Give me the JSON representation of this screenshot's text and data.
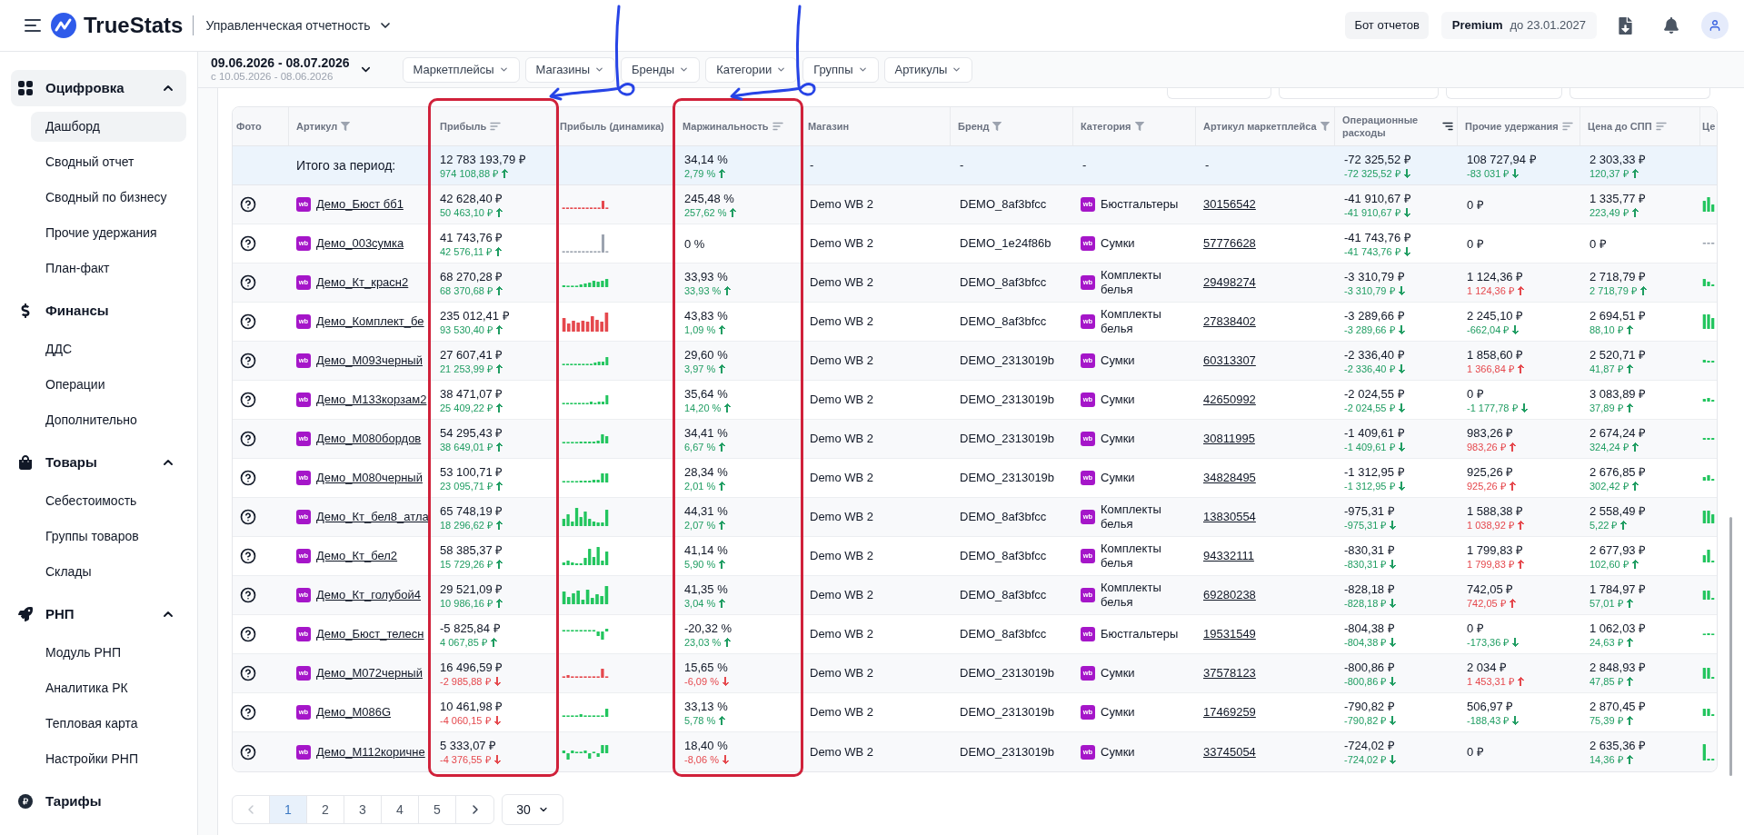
{
  "header": {
    "app_name": "TrueStats",
    "report": "Управленческая отчетность",
    "bot_button": "Бот отчетов",
    "plan": {
      "name": "Premium",
      "until": "до 23.01.2027"
    }
  },
  "sidebar": {
    "sections": [
      {
        "label": "Оцифровка",
        "active": true,
        "collapsible": true,
        "expanded": true,
        "items": [
          {
            "label": "Дашборд",
            "selected": true
          },
          {
            "label": "Сводный отчет",
            "selected": false
          },
          {
            "label": "Сводный по бизнесу",
            "selected": false
          },
          {
            "label": "Прочие удержания",
            "selected": false
          },
          {
            "label": "План-факт",
            "selected": false
          }
        ]
      },
      {
        "label": "Финансы",
        "active": false,
        "collapsible": false,
        "items": [
          {
            "label": "ДДС",
            "selected": false
          },
          {
            "label": "Операции",
            "selected": false
          },
          {
            "label": "Дополнительно",
            "selected": false
          }
        ]
      },
      {
        "label": "Товары",
        "active": false,
        "collapsible": true,
        "expanded": true,
        "items": [
          {
            "label": "Себестоимость",
            "selected": false
          },
          {
            "label": "Группы товаров",
            "selected": false
          },
          {
            "label": "Склады",
            "selected": false
          }
        ]
      },
      {
        "label": "РНП",
        "active": false,
        "collapsible": true,
        "expanded": true,
        "items": [
          {
            "label": "Модуль РНП",
            "selected": false
          },
          {
            "label": "Аналитика РК",
            "selected": false
          },
          {
            "label": "Тепловая карта",
            "selected": false
          },
          {
            "label": "Настройки РНП",
            "selected": false
          }
        ]
      },
      {
        "label": "Тарифы",
        "active": false,
        "collapsible": false
      }
    ]
  },
  "filters": {
    "period": "09.06.2026 - 08.07.2026",
    "comparison": "с 10.05.2026 - 08.06.2026",
    "chips": [
      "Маркетплейсы",
      "Магазины",
      "Бренды",
      "Категории",
      "Группы",
      "Артикулы"
    ]
  },
  "table": {
    "columns": [
      {
        "label": "Фото",
        "kind": "plain",
        "highlighted": false
      },
      {
        "label": "Артикул",
        "kind": "filter",
        "highlighted": false
      },
      {
        "label": "Прибыль",
        "kind": "sort",
        "sorted": false,
        "highlighted": true
      },
      {
        "label": "Прибыль (динамика)",
        "kind": "plain",
        "highlighted": false
      },
      {
        "label": "Маржинальность",
        "kind": "sort",
        "sorted": false,
        "highlighted": true
      },
      {
        "label": "Магазин",
        "kind": "plain",
        "highlighted": false
      },
      {
        "label": "Бренд",
        "kind": "filter",
        "highlighted": false
      },
      {
        "label": "Категория",
        "kind": "filter",
        "highlighted": false
      },
      {
        "label": "Артикул маркетплейса",
        "kind": "filter",
        "highlighted": false
      },
      {
        "label": "Операционные расходы",
        "kind": "sort",
        "sorted": true,
        "highlighted": false
      },
      {
        "label": "Прочие удержания",
        "kind": "sort",
        "sorted": false,
        "highlighted": false
      },
      {
        "label": "Цена до СПП",
        "kind": "sort",
        "sorted": false,
        "highlighted": false
      },
      {
        "label": "Це",
        "kind": "plain",
        "highlighted": false
      }
    ],
    "total": {
      "label": "Итого за период:",
      "profit": {
        "value": "12 783 193,79 ₽",
        "delta": {
          "value": "974 108,88 ₽",
          "rising": true,
          "color": "#1f9d62"
        }
      },
      "margin": {
        "value": "34,14 %",
        "delta": {
          "value": "2,79 %",
          "rising": true,
          "color": "#1f9d62"
        }
      },
      "store": "-",
      "brand": "-",
      "category": "-",
      "marketplace_article": "-",
      "operating_expenses": {
        "value": "-72 325,52 ₽",
        "delta": {
          "value": "-72 325,52 ₽",
          "rising": false,
          "color": "#1f9d62"
        }
      },
      "other_deductions": {
        "value": "108 727,94 ₽",
        "delta": {
          "value": "-83 031 ₽",
          "rising": false,
          "color": "#1f9d62"
        }
      },
      "price_before_spp": {
        "value": "2 303,33 ₽",
        "delta": {
          "value": "120,37 ₽",
          "rising": true,
          "color": "#1f9d62"
        }
      }
    },
    "rows": [
      {
        "article": {
          "badge": "wb",
          "name": "Демо_Бюст бб1"
        },
        "profit": {
          "value": "42 628,40 ₽",
          "delta": {
            "value": "50 463,10 ₽",
            "rising": true,
            "color": "#1f9d62"
          }
        },
        "profit_dynamics": {
          "color": "#e5484d"
        },
        "margin": {
          "value": "245,48 %",
          "delta": {
            "value": "257,62 %",
            "rising": true,
            "color": "#1f9d62"
          }
        },
        "store": "Demo WB 2",
        "brand": "DEMO_8af3bfcc",
        "category": {
          "badge": "wb",
          "name": "Бюстгальтеры"
        },
        "marketplace_article": "30156542",
        "operating_expenses": {
          "value": "-41 910,67 ₽",
          "delta": {
            "value": "-41 910,67 ₽",
            "rising": false,
            "color": "#1f9d62"
          }
        },
        "other_deductions": {
          "value": "0 ₽"
        },
        "price_before_spp": {
          "value": "1 335,77 ₽",
          "delta": {
            "value": "223,49 ₽",
            "rising": true,
            "color": "#1f9d62"
          }
        },
        "column_13": {
          "color": "#22c55e"
        }
      },
      {
        "article": {
          "badge": "wb",
          "name": "Демо_003сумка"
        },
        "profit": {
          "value": "41 743,76 ₽",
          "delta": {
            "value": "42 576,11 ₽",
            "rising": true,
            "color": "#1f9d62"
          }
        },
        "profit_dynamics": {
          "color": "#9ca3af"
        },
        "margin": {
          "value": "0 %"
        },
        "store": "Demo WB 2",
        "brand": "DEMO_1e24f86b",
        "category": {
          "badge": "wb",
          "name": "Сумки"
        },
        "marketplace_article": "57776628",
        "operating_expenses": {
          "value": "-41 743,76 ₽",
          "delta": {
            "value": "-41 743,76 ₽",
            "rising": false,
            "color": "#1f9d62"
          }
        },
        "other_deductions": {
          "value": "0 ₽"
        },
        "price_before_spp": {
          "value": "0 ₽"
        },
        "column_13": {
          "color": "#9ca3af"
        }
      },
      {
        "article": {
          "badge": "wb",
          "name": "Демо_Кт_красн2"
        },
        "profit": {
          "value": "68 270,28 ₽",
          "delta": {
            "value": "68 370,68 ₽",
            "rising": true,
            "color": "#1f9d62"
          }
        },
        "profit_dynamics": {
          "color": "#22c55e"
        },
        "margin": {
          "value": "33,93 %",
          "delta": {
            "value": "33,93 %",
            "rising": true,
            "color": "#1f9d62"
          }
        },
        "store": "Demo WB 2",
        "brand": "DEMO_8af3bfcc",
        "category": {
          "badge": "wb",
          "name": "Комплекты белья"
        },
        "marketplace_article": "29498274",
        "operating_expenses": {
          "value": "-3 310,79 ₽",
          "delta": {
            "value": "-3 310,79 ₽",
            "rising": false,
            "color": "#1f9d62"
          }
        },
        "other_deductions": {
          "value": "1 124,36 ₽",
          "delta": {
            "value": "1 124,36 ₽",
            "rising": true,
            "color": "#e5484d"
          }
        },
        "price_before_spp": {
          "value": "2 718,79 ₽",
          "delta": {
            "value": "2 718,79 ₽",
            "rising": true,
            "color": "#1f9d62"
          }
        },
        "column_13": {
          "color": "#22c55e"
        }
      },
      {
        "article": {
          "badge": "wb",
          "name": "Демо_Комплект_бе"
        },
        "profit": {
          "value": "235 012,41 ₽",
          "delta": {
            "value": "93 530,40 ₽",
            "rising": true,
            "color": "#1f9d62"
          }
        },
        "profit_dynamics": {
          "color": "#e5484d"
        },
        "margin": {
          "value": "43,83 %",
          "delta": {
            "value": "1,09 %",
            "rising": true,
            "color": "#1f9d62"
          }
        },
        "store": "Demo WB 2",
        "brand": "DEMO_8af3bfcc",
        "category": {
          "badge": "wb",
          "name": "Комплекты белья"
        },
        "marketplace_article": "27838402",
        "operating_expenses": {
          "value": "-3 289,66 ₽",
          "delta": {
            "value": "-3 289,66 ₽",
            "rising": false,
            "color": "#1f9d62"
          }
        },
        "other_deductions": {
          "value": "2 245,10 ₽",
          "delta": {
            "value": "-662,04 ₽",
            "rising": false,
            "color": "#1f9d62"
          }
        },
        "price_before_spp": {
          "value": "2 694,51 ₽",
          "delta": {
            "value": "88,10 ₽",
            "rising": true,
            "color": "#1f9d62"
          }
        },
        "column_13": {
          "color": "#22c55e"
        }
      },
      {
        "article": {
          "badge": "wb",
          "name": "Демо_М093черный"
        },
        "profit": {
          "value": "27 607,41 ₽",
          "delta": {
            "value": "21 253,99 ₽",
            "rising": true,
            "color": "#1f9d62"
          }
        },
        "profit_dynamics": {
          "color": "#22c55e"
        },
        "margin": {
          "value": "29,60 %",
          "delta": {
            "value": "3,97 %",
            "rising": true,
            "color": "#1f9d62"
          }
        },
        "store": "Demo WB 2",
        "brand": "DEMO_2313019b",
        "category": {
          "badge": "wb",
          "name": "Сумки"
        },
        "marketplace_article": "60313307",
        "operating_expenses": {
          "value": "-2 336,40 ₽",
          "delta": {
            "value": "-2 336,40 ₽",
            "rising": false,
            "color": "#1f9d62"
          }
        },
        "other_deductions": {
          "value": "1 858,60 ₽",
          "delta": {
            "value": "1 366,84 ₽",
            "rising": true,
            "color": "#e5484d"
          }
        },
        "price_before_spp": {
          "value": "2 520,71 ₽",
          "delta": {
            "value": "41,87 ₽",
            "rising": true,
            "color": "#1f9d62"
          }
        },
        "column_13": {
          "color": "#22c55e"
        }
      },
      {
        "article": {
          "badge": "wb",
          "name": "Демо_М133корзам2"
        },
        "profit": {
          "value": "38 471,07 ₽",
          "delta": {
            "value": "25 409,22 ₽",
            "rising": true,
            "color": "#1f9d62"
          }
        },
        "profit_dynamics": {
          "color": "#22c55e"
        },
        "margin": {
          "value": "35,64 %",
          "delta": {
            "value": "14,20 %",
            "rising": true,
            "color": "#1f9d62"
          }
        },
        "store": "Demo WB 2",
        "brand": "DEMO_2313019b",
        "category": {
          "badge": "wb",
          "name": "Сумки"
        },
        "marketplace_article": "42650992",
        "operating_expenses": {
          "value": "-2 024,55 ₽",
          "delta": {
            "value": "-2 024,55 ₽",
            "rising": false,
            "color": "#1f9d62"
          }
        },
        "other_deductions": {
          "value": "0 ₽",
          "delta": {
            "value": "-1 177,78 ₽",
            "rising": false,
            "color": "#1f9d62"
          }
        },
        "price_before_spp": {
          "value": "3 083,89 ₽",
          "delta": {
            "value": "37,89 ₽",
            "rising": true,
            "color": "#1f9d62"
          }
        },
        "column_13": {
          "color": "#22c55e"
        }
      },
      {
        "article": {
          "badge": "wb",
          "name": "Демо_М080бордов"
        },
        "profit": {
          "value": "54 295,43 ₽",
          "delta": {
            "value": "38 649,01 ₽",
            "rising": true,
            "color": "#1f9d62"
          }
        },
        "profit_dynamics": {
          "color": "#22c55e"
        },
        "margin": {
          "value": "34,41 %",
          "delta": {
            "value": "6,67 %",
            "rising": true,
            "color": "#1f9d62"
          }
        },
        "store": "Demo WB 2",
        "brand": "DEMO_2313019b",
        "category": {
          "badge": "wb",
          "name": "Сумки"
        },
        "marketplace_article": "30811995",
        "operating_expenses": {
          "value": "-1 409,61 ₽",
          "delta": {
            "value": "-1 409,61 ₽",
            "rising": false,
            "color": "#1f9d62"
          }
        },
        "other_deductions": {
          "value": "983,26 ₽",
          "delta": {
            "value": "983,26 ₽",
            "rising": true,
            "color": "#e5484d"
          }
        },
        "price_before_spp": {
          "value": "2 674,24 ₽",
          "delta": {
            "value": "324,24 ₽",
            "rising": true,
            "color": "#1f9d62"
          }
        },
        "column_13": {
          "color": "#22c55e"
        }
      },
      {
        "article": {
          "badge": "wb",
          "name": "Демо_М080черный"
        },
        "profit": {
          "value": "53 100,71 ₽",
          "delta": {
            "value": "23 095,71 ₽",
            "rising": true,
            "color": "#1f9d62"
          }
        },
        "profit_dynamics": {
          "color": "#22c55e"
        },
        "margin": {
          "value": "28,34 %",
          "delta": {
            "value": "2,01 %",
            "rising": true,
            "color": "#1f9d62"
          }
        },
        "store": "Demo WB 2",
        "brand": "DEMO_2313019b",
        "category": {
          "badge": "wb",
          "name": "Сумки"
        },
        "marketplace_article": "34828495",
        "operating_expenses": {
          "value": "-1 312,95 ₽",
          "delta": {
            "value": "-1 312,95 ₽",
            "rising": false,
            "color": "#1f9d62"
          }
        },
        "other_deductions": {
          "value": "925,26 ₽",
          "delta": {
            "value": "925,26 ₽",
            "rising": true,
            "color": "#e5484d"
          }
        },
        "price_before_spp": {
          "value": "2 676,85 ₽",
          "delta": {
            "value": "302,42 ₽",
            "rising": true,
            "color": "#1f9d62"
          }
        },
        "column_13": {
          "color": "#22c55e"
        }
      },
      {
        "article": {
          "badge": "wb",
          "name": "Демо_Кт_бел8_атла"
        },
        "profit": {
          "value": "65 748,19 ₽",
          "delta": {
            "value": "18 296,62 ₽",
            "rising": true,
            "color": "#1f9d62"
          }
        },
        "profit_dynamics": {
          "color": "#22c55e"
        },
        "margin": {
          "value": "44,31 %",
          "delta": {
            "value": "2,07 %",
            "rising": true,
            "color": "#1f9d62"
          }
        },
        "store": "Demo WB 2",
        "brand": "DEMO_8af3bfcc",
        "category": {
          "badge": "wb",
          "name": "Комплекты белья"
        },
        "marketplace_article": "13830554",
        "operating_expenses": {
          "value": "-975,31 ₽",
          "delta": {
            "value": "-975,31 ₽",
            "rising": false,
            "color": "#1f9d62"
          }
        },
        "other_deductions": {
          "value": "1 588,38 ₽",
          "delta": {
            "value": "1 038,92 ₽",
            "rising": true,
            "color": "#e5484d"
          }
        },
        "price_before_spp": {
          "value": "2 558,49 ₽",
          "delta": {
            "value": "5,22 ₽",
            "rising": true,
            "color": "#1f9d62"
          }
        },
        "column_13": {
          "color": "#22c55e"
        }
      },
      {
        "article": {
          "badge": "wb",
          "name": "Демо_Кт_бел2"
        },
        "profit": {
          "value": "58 385,37 ₽",
          "delta": {
            "value": "15 729,26 ₽",
            "rising": true,
            "color": "#1f9d62"
          }
        },
        "profit_dynamics": {
          "color": "#22c55e"
        },
        "margin": {
          "value": "41,14 %",
          "delta": {
            "value": "5,90 %",
            "rising": true,
            "color": "#1f9d62"
          }
        },
        "store": "Demo WB 2",
        "brand": "DEMO_8af3bfcc",
        "category": {
          "badge": "wb",
          "name": "Комплекты белья"
        },
        "marketplace_article": "94332111",
        "operating_expenses": {
          "value": "-830,31 ₽",
          "delta": {
            "value": "-830,31 ₽",
            "rising": false,
            "color": "#1f9d62"
          }
        },
        "other_deductions": {
          "value": "1 799,83 ₽",
          "delta": {
            "value": "1 799,83 ₽",
            "rising": true,
            "color": "#e5484d"
          }
        },
        "price_before_spp": {
          "value": "2 677,93 ₽",
          "delta": {
            "value": "102,60 ₽",
            "rising": true,
            "color": "#1f9d62"
          }
        },
        "column_13": {
          "color": "#22c55e"
        }
      },
      {
        "article": {
          "badge": "wb",
          "name": "Демо_Кт_голубой4"
        },
        "profit": {
          "value": "29 521,09 ₽",
          "delta": {
            "value": "10 986,16 ₽",
            "rising": true,
            "color": "#1f9d62"
          }
        },
        "profit_dynamics": {
          "color": "#22c55e"
        },
        "margin": {
          "value": "41,35 %",
          "delta": {
            "value": "3,04 %",
            "rising": true,
            "color": "#1f9d62"
          }
        },
        "store": "Demo WB 2",
        "brand": "DEMO_8af3bfcc",
        "category": {
          "badge": "wb",
          "name": "Комплекты белья"
        },
        "marketplace_article": "69280238",
        "operating_expenses": {
          "value": "-828,18 ₽",
          "delta": {
            "value": "-828,18 ₽",
            "rising": false,
            "color": "#1f9d62"
          }
        },
        "other_deductions": {
          "value": "742,05 ₽",
          "delta": {
            "value": "742,05 ₽",
            "rising": true,
            "color": "#e5484d"
          }
        },
        "price_before_spp": {
          "value": "1 784,97 ₽",
          "delta": {
            "value": "57,01 ₽",
            "rising": true,
            "color": "#1f9d62"
          }
        },
        "column_13": {
          "color": "#22c55e"
        }
      },
      {
        "article": {
          "badge": "wb",
          "name": "Демо_Бюст_телесн"
        },
        "profit": {
          "value": "-5 825,84 ₽",
          "delta": {
            "value": "4 067,85 ₽",
            "rising": true,
            "color": "#1f9d62"
          }
        },
        "profit_dynamics": {
          "color": "#22c55e"
        },
        "margin": {
          "value": "-20,32 %",
          "delta": {
            "value": "23,03 %",
            "rising": true,
            "color": "#1f9d62"
          }
        },
        "store": "Demo WB 2",
        "brand": "DEMO_8af3bfcc",
        "category": {
          "badge": "wb",
          "name": "Бюстгальтеры"
        },
        "marketplace_article": "19531549",
        "operating_expenses": {
          "value": "-804,38 ₽",
          "delta": {
            "value": "-804,38 ₽",
            "rising": false,
            "color": "#1f9d62"
          }
        },
        "other_deductions": {
          "value": "0 ₽",
          "delta": {
            "value": "-173,36 ₽",
            "rising": false,
            "color": "#1f9d62"
          }
        },
        "price_before_spp": {
          "value": "1 062,03 ₽",
          "delta": {
            "value": "24,63 ₽",
            "rising": true,
            "color": "#1f9d62"
          }
        },
        "column_13": {
          "color": "#22c55e"
        }
      },
      {
        "article": {
          "badge": "wb",
          "name": "Демо_М072черный"
        },
        "profit": {
          "value": "16 496,59 ₽",
          "delta": {
            "value": "-2 985,88 ₽",
            "rising": false,
            "color": "#e5484d"
          }
        },
        "profit_dynamics": {
          "color": "#e5484d"
        },
        "margin": {
          "value": "15,65 %",
          "delta": {
            "value": "-6,09 %",
            "rising": false,
            "color": "#e5484d"
          }
        },
        "store": "Demo WB 2",
        "brand": "DEMO_2313019b",
        "category": {
          "badge": "wb",
          "name": "Сумки"
        },
        "marketplace_article": "37578123",
        "operating_expenses": {
          "value": "-800,86 ₽",
          "delta": {
            "value": "-800,86 ₽",
            "rising": false,
            "color": "#1f9d62"
          }
        },
        "other_deductions": {
          "value": "2 034 ₽",
          "delta": {
            "value": "1 453,31 ₽",
            "rising": true,
            "color": "#e5484d"
          }
        },
        "price_before_spp": {
          "value": "2 848,93 ₽",
          "delta": {
            "value": "47,85 ₽",
            "rising": true,
            "color": "#1f9d62"
          }
        },
        "column_13": {
          "color": "#22c55e"
        }
      },
      {
        "article": {
          "badge": "wb",
          "name": "Демо_М086G"
        },
        "profit": {
          "value": "10 461,98 ₽",
          "delta": {
            "value": "-4 060,15 ₽",
            "rising": false,
            "color": "#e5484d"
          }
        },
        "profit_dynamics": {
          "color": "#22c55e"
        },
        "margin": {
          "value": "33,13 %",
          "delta": {
            "value": "5,78 %",
            "rising": true,
            "color": "#1f9d62"
          }
        },
        "store": "Demo WB 2",
        "brand": "DEMO_2313019b",
        "category": {
          "badge": "wb",
          "name": "Сумки"
        },
        "marketplace_article": "17469259",
        "operating_expenses": {
          "value": "-790,82 ₽",
          "delta": {
            "value": "-790,82 ₽",
            "rising": false,
            "color": "#1f9d62"
          }
        },
        "other_deductions": {
          "value": "506,97 ₽",
          "delta": {
            "value": "-188,43 ₽",
            "rising": false,
            "color": "#1f9d62"
          }
        },
        "price_before_spp": {
          "value": "2 870,45 ₽",
          "delta": {
            "value": "75,39 ₽",
            "rising": true,
            "color": "#1f9d62"
          }
        },
        "column_13": {
          "color": "#22c55e"
        }
      },
      {
        "article": {
          "badge": "wb",
          "name": "Демо_М112коричне"
        },
        "profit": {
          "value": "5 333,07 ₽",
          "delta": {
            "value": "-4 376,55 ₽",
            "rising": false,
            "color": "#e5484d"
          }
        },
        "profit_dynamics": {
          "color": "#22c55e"
        },
        "margin": {
          "value": "18,40 %",
          "delta": {
            "value": "-8,06 %",
            "rising": false,
            "color": "#e5484d"
          }
        },
        "store": "Demo WB 2",
        "brand": "DEMO_2313019b",
        "category": {
          "badge": "wb",
          "name": "Сумки"
        },
        "marketplace_article": "33745054",
        "operating_expenses": {
          "value": "-724,02 ₽",
          "delta": {
            "value": "-724,02 ₽",
            "rising": false,
            "color": "#1f9d62"
          }
        },
        "other_deductions": {
          "value": "0 ₽"
        },
        "price_before_spp": {
          "value": "2 635,36 ₽",
          "delta": {
            "value": "14,36 ₽",
            "rising": true,
            "color": "#1f9d62"
          }
        },
        "column_13": {
          "color": "#22c55e"
        }
      }
    ]
  },
  "pagination": {
    "previous": {
      "disabled": true
    },
    "next": {
      "disabled": false
    },
    "pages": [
      {
        "label": "1",
        "selected": true
      },
      {
        "label": "2",
        "selected": false
      },
      {
        "label": "3",
        "selected": false
      },
      {
        "label": "4",
        "selected": false
      },
      {
        "label": "5",
        "selected": false
      }
    ],
    "page_size": "30"
  }
}
